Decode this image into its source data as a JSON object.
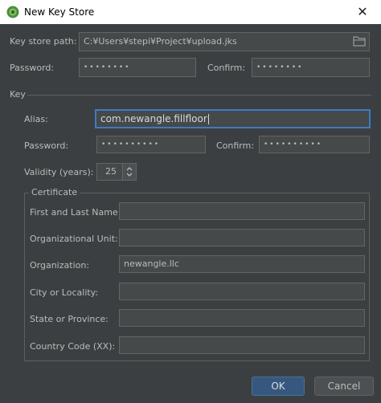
{
  "window": {
    "title": "New Key Store",
    "close_glyph": "✕"
  },
  "keystore": {
    "path_label": "Key store path:",
    "path_value": "C:¥Users¥stepi¥Project¥upload.jks",
    "password_label": "Password:",
    "password_value": "••••••••",
    "confirm_label": "Confirm:",
    "confirm_value": "••••••••"
  },
  "key": {
    "section_label": "Key",
    "alias_label": "Alias:",
    "alias_value": "com.newangle.fillfloor",
    "password_label": "Password:",
    "password_value": "••••••••••",
    "confirm_label": "Confirm:",
    "confirm_value": "••••••••••",
    "validity_label": "Validity (years):",
    "validity_value": "25"
  },
  "certificate": {
    "section_label": "Certificate",
    "fields": [
      {
        "label": "First and Last Name:",
        "value": ""
      },
      {
        "label": "Organizational Unit:",
        "value": ""
      },
      {
        "label": "Organization:",
        "value": "newangle.llc"
      },
      {
        "label": "City or Locality:",
        "value": ""
      },
      {
        "label": "State or Province:",
        "value": ""
      },
      {
        "label": "Country Code (XX):",
        "value": ""
      }
    ]
  },
  "buttons": {
    "ok": "OK",
    "cancel": "Cancel"
  },
  "icons": {
    "app": "android-studio-icon",
    "folder": "folder-icon",
    "close": "close-icon"
  },
  "colors": {
    "background": "#3c3f41",
    "focus": "#3d7bc4",
    "primary_button": "#365880"
  }
}
